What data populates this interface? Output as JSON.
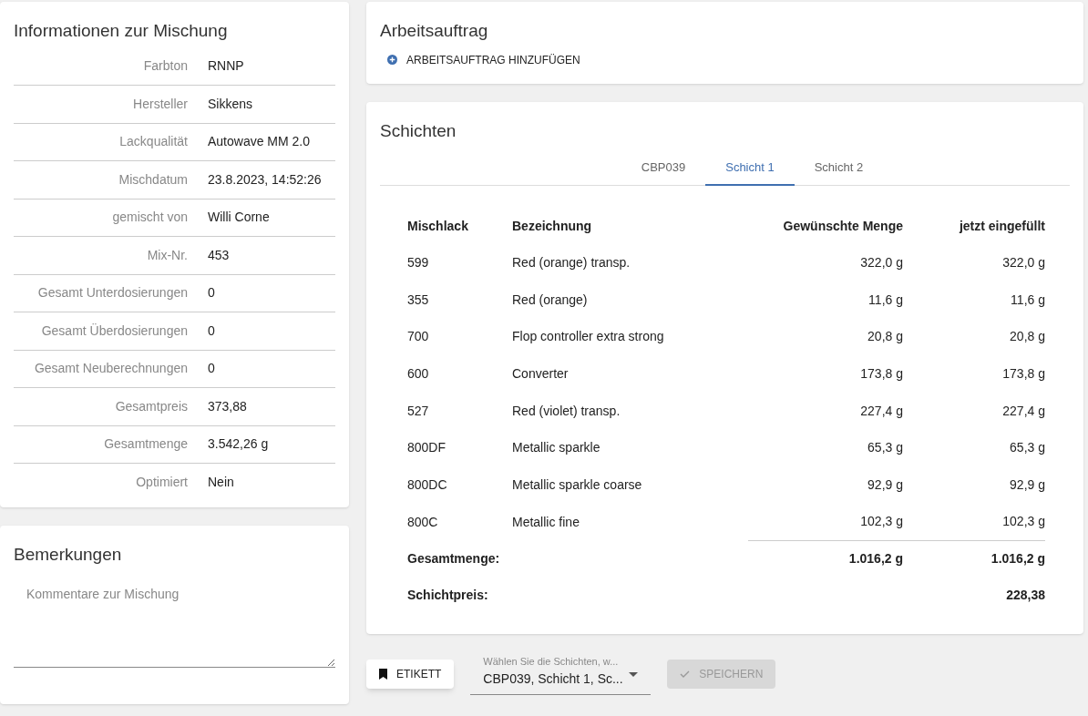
{
  "info": {
    "title": "Informationen zur Mischung",
    "rows": [
      {
        "label": "Farbton",
        "value": "RNNP"
      },
      {
        "label": "Hersteller",
        "value": "Sikkens"
      },
      {
        "label": "Lackqualität",
        "value": "Autowave MM 2.0"
      },
      {
        "label": "Mischdatum",
        "value": "23.8.2023, 14:52:26"
      },
      {
        "label": "gemischt von",
        "value": "Willi Corne"
      },
      {
        "label": "Mix-Nr.",
        "value": "453"
      },
      {
        "label": "Gesamt Unterdosierungen",
        "value": "0"
      },
      {
        "label": "Gesamt Überdosierungen",
        "value": "0"
      },
      {
        "label": "Gesamt Neuberechnungen",
        "value": "0"
      },
      {
        "label": "Gesamtpreis",
        "value": "373,88"
      },
      {
        "label": "Gesamtmenge",
        "value": "3.542,26 g"
      },
      {
        "label": "Optimiert",
        "value": "Nein"
      }
    ]
  },
  "remarks": {
    "title": "Bemerkungen",
    "placeholder": "Kommentare zur Mischung"
  },
  "work_order": {
    "title": "Arbeitsauftrag",
    "add_link": "ARBEITSAUFTRAG HINZUFÜGEN"
  },
  "layers": {
    "title": "Schichten",
    "tabs": [
      {
        "label": "CBP039",
        "selected": false
      },
      {
        "label": "Schicht 1",
        "selected": true
      },
      {
        "label": "Schicht 2",
        "selected": false
      }
    ],
    "columns": [
      "Mischlack",
      "Bezeichnung",
      "Gewünschte Menge",
      "jetzt eingefüllt"
    ],
    "rows": [
      [
        "599",
        "Red (orange) transp.",
        "322,0 g",
        "322,0 g"
      ],
      [
        "355",
        "Red (orange)",
        "11,6 g",
        "11,6 g"
      ],
      [
        "700",
        "Flop controller extra strong",
        "20,8 g",
        "20,8 g"
      ],
      [
        "600",
        "Converter",
        "173,8 g",
        "173,8 g"
      ],
      [
        "527",
        "Red (violet) transp.",
        "227,4 g",
        "227,4 g"
      ],
      [
        "800DF",
        "Metallic sparkle",
        "65,3 g",
        "65,3 g"
      ],
      [
        "800DC",
        "Metallic sparkle coarse",
        "92,9 g",
        "92,9 g"
      ],
      [
        "800C",
        "Metallic fine",
        "102,3 g",
        "102,3 g"
      ]
    ],
    "total": {
      "label": "Gesamtmenge:",
      "wanted": "1.016,2 g",
      "filled": "1.016,2 g"
    },
    "price": {
      "label": "Schichtpreis:",
      "value": "228,38"
    }
  },
  "actions": {
    "label_button": "ETIKETT",
    "select": {
      "label": "Wählen Sie die Schichten, w...",
      "value": "CBP039, Schicht 1, Sc..."
    },
    "save_button": {
      "label": "SPEICHERN",
      "disabled": true
    }
  }
}
